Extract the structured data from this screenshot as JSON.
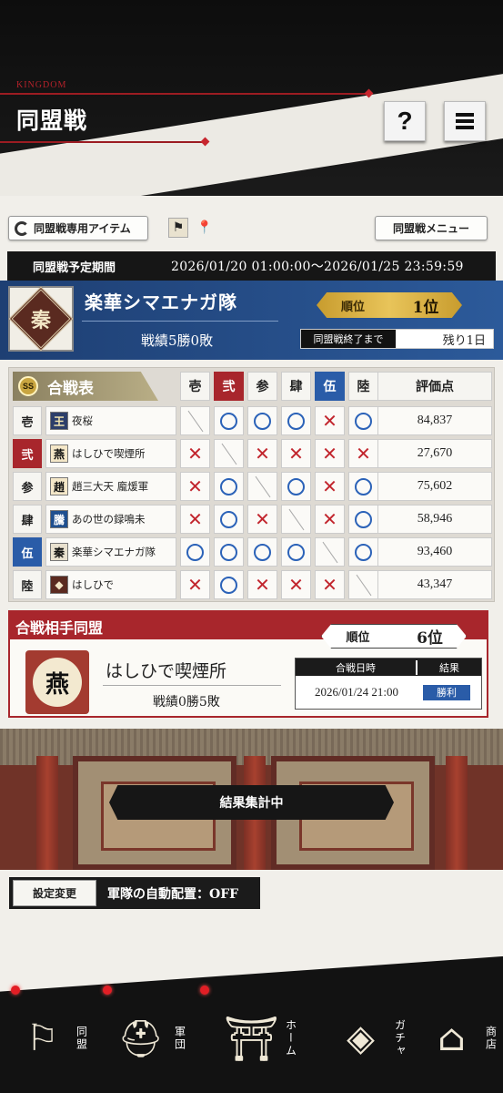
{
  "header": {
    "brand": "KINGDOM",
    "title": "同盟戦",
    "help_label": "?"
  },
  "toolbar": {
    "items_button": "同盟戦専用アイテム",
    "menu_button": "同盟戦メニュー"
  },
  "period": {
    "label": "同盟戦予定期間",
    "value": "2026/01/20 01:00:00～2026/01/25 23:59:59"
  },
  "alliance": {
    "crest_char": "秦",
    "name": "楽華シマエナガ隊",
    "record": "戦績5勝0敗",
    "rank_label": "順位",
    "rank_value": "1位",
    "remain_label": "同盟戦終了まで",
    "remain_value": "残り1日"
  },
  "battle_table": {
    "title": "合戦表",
    "ss_badge": "SS",
    "columns": [
      "壱",
      "弐",
      "参",
      "肆",
      "伍",
      "陸"
    ],
    "score_header": "評価点",
    "rows": [
      {
        "id": "壱",
        "badge": "王",
        "name": "夜桜",
        "results": [
          "-",
          "o",
          "o",
          "o",
          "x",
          "o"
        ],
        "score": "84,837"
      },
      {
        "id": "弐",
        "badge": "燕",
        "name": "はしひで喫煙所",
        "results": [
          "x",
          "-",
          "x",
          "x",
          "x",
          "x"
        ],
        "score": "27,670"
      },
      {
        "id": "参",
        "badge": "趙",
        "name": "趙三大天 龐煖軍",
        "results": [
          "x",
          "o",
          "-",
          "o",
          "x",
          "o"
        ],
        "score": "75,602"
      },
      {
        "id": "肆",
        "badge": "騰",
        "name": "あの世の録鳴未",
        "results": [
          "x",
          "o",
          "x",
          "-",
          "x",
          "o"
        ],
        "score": "58,946"
      },
      {
        "id": "伍",
        "badge": "秦",
        "name": "楽華シマエナガ隊",
        "results": [
          "o",
          "o",
          "o",
          "o",
          "-",
          "o"
        ],
        "score": "93,460"
      },
      {
        "id": "陸",
        "badge": "◆",
        "name": "はしひで",
        "results": [
          "x",
          "o",
          "x",
          "x",
          "x",
          "-"
        ],
        "score": "43,347"
      }
    ]
  },
  "opponent": {
    "title": "合戦相手同盟",
    "rank_label": "順位",
    "rank_value": "6位",
    "crest_char": "燕",
    "name": "はしひで喫煙所",
    "record": "戦績0勝5敗",
    "date_header": "合戦日時",
    "result_header": "結果",
    "date": "2026/01/24 21:00",
    "result": "勝利"
  },
  "field": {
    "status": "結果集計中"
  },
  "settings": {
    "button": "設定変更",
    "text": "軍隊の自動配置：OFF"
  },
  "nav": [
    {
      "label": "同盟",
      "icon": "flag-icon"
    },
    {
      "label": "軍団",
      "icon": "helmet-icon"
    },
    {
      "label": "ホーム",
      "icon": "castle-icon"
    },
    {
      "label": "ガチャ",
      "icon": "gacha-icon"
    },
    {
      "label": "商店",
      "icon": "shop-icon"
    }
  ]
}
